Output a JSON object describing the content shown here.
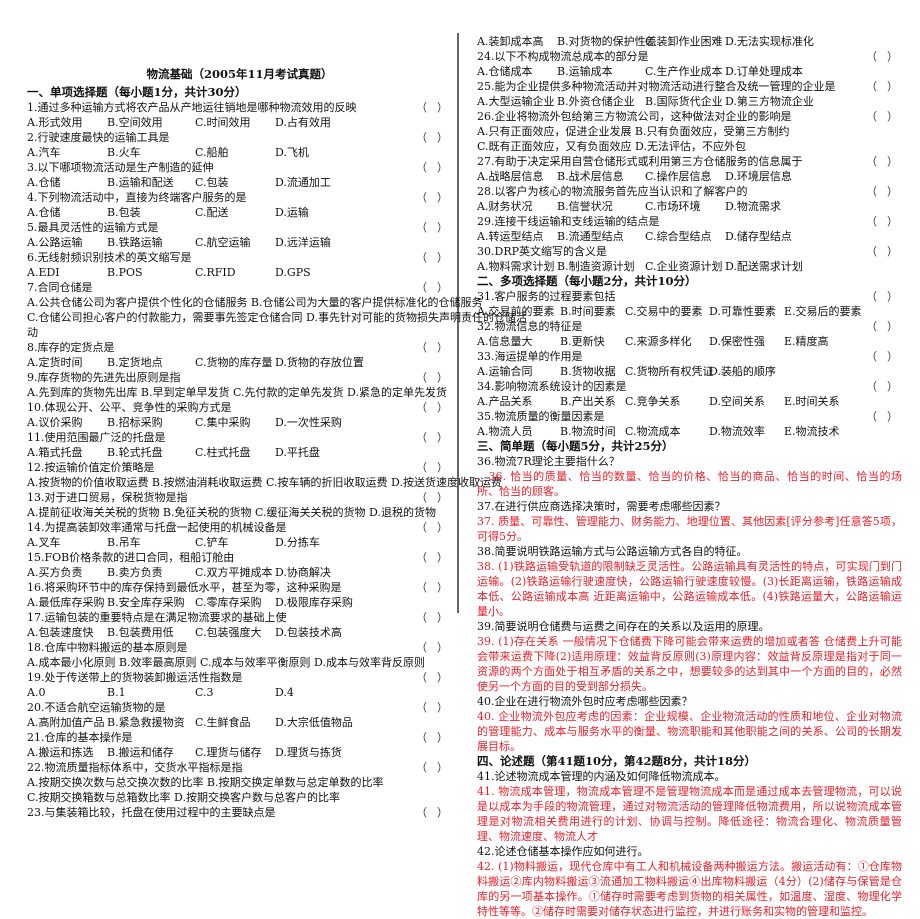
{
  "doc": {
    "title": "物流基础（2005年11月考试真题）",
    "paren_open": "（",
    "paren_close": "）",
    "colors": {
      "text": "#111111",
      "answer_red": "#e8212b",
      "divider": "#666666"
    }
  },
  "section1": {
    "heading": "一、单项选择题（每小题1分，共计30分）",
    "questions": [
      {
        "q": "1.通过多种运输方式将农产品从产地运往销地是哪种物流效用的反映",
        "opts": [
          "A.形式效用",
          "B.空间效用",
          "C.时间效用",
          "D.占有效用"
        ]
      },
      {
        "q": "2.行驶速度最快的运输工具是",
        "opts": [
          "A.汽车",
          "B.火车",
          "C.船舶",
          "D.飞机"
        ]
      },
      {
        "q": "3.以下哪项物流活动是生产制造的延伸",
        "opts": [
          "A.仓储",
          "B.运输和配送",
          "C.包装",
          "D.流通加工"
        ]
      },
      {
        "q": "4.下列物流活动中，直接为终端客户服务的是",
        "opts": [
          "A.仓储",
          "B.包装",
          "C.配送",
          "D.运输"
        ]
      },
      {
        "q": "5.最具灵活性的运输方式是",
        "opts": [
          "A.公路运输",
          "B.铁路运输",
          "C.航空运输",
          "D.远洋运输"
        ]
      },
      {
        "q": "6.无线射频识别技术的英文缩写是",
        "opts": [
          "A.EDI",
          "B.POS",
          "C.RFID",
          "D.GPS"
        ]
      },
      {
        "q": "7.合同仓储是",
        "lines": [
          "A.公共仓储公司为客户提供个性化的仓储服务  B.仓储公司为大量的客户提供标准化的仓储服务",
          "C.仓储公司担心客户的付款能力，需要事先签定仓储合同  D.事先针对可能的货物损失声明责任的仓储活",
          "动"
        ]
      },
      {
        "q": "8.库存的定货点是",
        "opts": [
          "A.定货时间",
          "B.定货地点",
          "C.货物的库存量",
          "D.货物的存放位置"
        ]
      },
      {
        "q": "9.库存货物的先进先出原则是指",
        "lines": [
          "A.先到库的货物先出库  B.早到定单早发货  C.先付款的定单先发货  D.紧急的定单先发货"
        ]
      },
      {
        "q": "10.体现公开、公平、竞争性的采购方式是",
        "opts": [
          "A.议价采购",
          "B.招标采购",
          "C.集中采购",
          "D.一次性采购"
        ]
      },
      {
        "q": "11.使用范围最广泛的托盘是",
        "opts": [
          "A.箱式托盘",
          "B.轮式托盘",
          "C.柱式托盘",
          "D.平托盘"
        ]
      },
      {
        "q": "12.按运输价值定价策略是",
        "lines": [
          "A.按货物的价值收取运费 B.按燃油消耗收取运费 C.按车辆的折旧收取运费 D.按送货速度收取运费"
        ]
      },
      {
        "q": "13.对于进口贸易，保税货物是指",
        "lines": [
          "A.提前征收海关关税的货物  B.免征关税的货物  C.缓征海关关税的货物    D.退税的货物"
        ]
      },
      {
        "q": "14.为提高装卸效率通常与托盘一起使用的机械设备是",
        "opts": [
          "A.叉车",
          "B.吊车",
          "C.铲车",
          "D.分拣车"
        ]
      },
      {
        "q": "15.FOB价格条款的进口合同，租船订舱由",
        "opts": [
          "A.买方负责",
          "B.卖方负责",
          "C.双方平摊成本",
          "D.协商解决"
        ]
      },
      {
        "q": "16.将采购环节中的库存保持到最低水平，甚至为零，这种采购是",
        "opts": [
          "A.最低库存采购",
          "B.安全库存采购",
          "C.零库存采购",
          "D.极限库存采购"
        ]
      },
      {
        "q": "17.运输包装的重要特点是在满足物流要求的基础上使",
        "opts": [
          "A.包装速度快",
          "B.包装费用低",
          "C.包装强度大",
          "D.包装技术高"
        ]
      },
      {
        "q": "18.仓库中物料搬运的基本原则是",
        "lines": [
          "A.成本最小化原则   B.效率最高原则   C.成本与效率平衡原则   D.成本与效率背反原则"
        ]
      },
      {
        "q": "19.处于传送带上的货物装卸搬运活性指数是",
        "opts": [
          "A.0",
          "B.1",
          "C.3",
          "D.4"
        ]
      },
      {
        "q": "20.不适合航空运输货物的是",
        "opts": [
          "A.高附加值产品",
          "B.紧急救援物资",
          "C.生鲜食品",
          "D.大宗低值物品"
        ]
      },
      {
        "q": "21.仓库的基本操作是",
        "opts": [
          "A.搬运和拣选",
          "B.搬运和储存",
          "C.理货与储存",
          "D.理货与拣货"
        ]
      },
      {
        "q": "22.物流质量指标体系中，交货水平指标是指",
        "lines": [
          "A.按期交换次数与总交换次数的比率        B.按期交换定单数与总定单数的比率",
          "C.按期交换箱数与总箱数比率              D.按期交换客户数与总客户的比率"
        ]
      },
      {
        "q": "23.与集装箱比较，托盘在使用过程中的主要缺点是",
        "opts": [
          "A.装卸成本高",
          "B.对货物的保护性差",
          "C.装卸作业困难",
          "D.无法实现标准化"
        ]
      },
      {
        "q": "24.以下不构成物流总成本的部分是",
        "opts": [
          "A.仓储成本",
          "B.运输成本",
          "C.生产作业成本",
          "D.订单处理成本"
        ]
      },
      {
        "q": "25.能为企业提供多种物流活动并对物流活动进行整合及统一管理的企业是",
        "opts": [
          "A.大型运输企业",
          "B.外资仓储企业",
          "B.国际货代企业",
          "D.第三方物流企业"
        ]
      },
      {
        "q": "26.企业将物流外包给第三方物流公司，这种做法对企业的影响是",
        "lines": [
          "A.只有正面效应，促进企业发展                B.只有负面效应，受第三方制约",
          "C.既有正面效应，又有负面效应                D.无法评估，不应外包"
        ]
      },
      {
        "q": "27.有助于决定采用自营仓储形式或利用第三方仓储服务的信息属于",
        "opts": [
          "A.战略层信息",
          "B.战术层信息",
          "C.操作层信息",
          "D.环境层信息"
        ]
      },
      {
        "q": "28.以客户为核心的物流服务首先应当认识和了解客户的",
        "opts": [
          "A.财务状况",
          "B.信誉状况",
          "C.市场环境",
          "D.物流需求"
        ]
      },
      {
        "q": "29.连接干线运输和支线运输的结点是",
        "opts": [
          "A.转运型结点",
          "B.流通型结点",
          "C.综合型结点",
          "D.储存型结点"
        ]
      },
      {
        "q": "30.DRP英文缩写的含义是",
        "opts": [
          "A.物料需求计划",
          "B.制造资源计划",
          "C.企业资源计划",
          "D.配送需求计划"
        ]
      }
    ]
  },
  "section2": {
    "heading": "二、多项选择题（每小题2分，共计10分）",
    "questions": [
      {
        "q": "31.客户服务的过程要素包括",
        "opts": [
          "A.交易前的要素",
          "B.时间要素",
          "C.交易中的要素",
          "D.可靠性要素",
          "E.交易后的要素"
        ]
      },
      {
        "q": "32.物流信息的特征是",
        "opts": [
          "A.信息量大",
          "B.更新快",
          "C.来源多样化",
          "D.保密性强",
          "E.精度高"
        ]
      },
      {
        "q": "33.海运提单的作用是",
        "opts": [
          "A.运输合同",
          "B.货物收据",
          "C.货物所有权凭证",
          "D.装船的顺序"
        ]
      },
      {
        "q": "34.影响物流系统设计的因素是",
        "opts": [
          "A.产品关系",
          "B.产出关系",
          "C.竞争关系",
          "D.空间关系",
          "E.时间关系"
        ]
      },
      {
        "q": "35.物流质量的衡量因素是",
        "opts": [
          "A.物流人员",
          "B.物流时间",
          "C.物流成本",
          "D.物流效率",
          "E.物流技术"
        ]
      }
    ]
  },
  "section3": {
    "heading": "三、简单题（每小题5分，共计25分）",
    "items": [
      {
        "q": "36.物流7R理论主要指什么？",
        "a": "      、36. 恰当的质量、恰当的数量、恰当的价格、恰当的商品、恰当的时间、恰当的场所、恰当的顾客。"
      },
      {
        "q": "37.在进行供应商选择决策时，需要考虑哪些因素？",
        "a": "37. 质量、可靠性、管理能力、财务能力、地理位置、其他因素[评分参考]任意答5项，可得5分。"
      },
      {
        "q": "38.简要说明铁路运输方式与公路运输方式各自的特征。",
        "a": "38. (1)铁路运输受轨道的限制缺乏灵活性。公路运输具有灵活性的特点，可实现门到门运输。(2)铁路运输行驶速度快，公路运输行驶速度较慢。(3)长距离运输，铁路运输成本低、公路运输成本高 近距离运输中，公路运输成本低。(4)铁路运量大，公路运输运量小。"
      },
      {
        "q": "39.简要说明仓储费与运费之间存在的关系以及运用的原理。",
        "a": "39. (1)存在关系 一般情况下仓储费下降可能会带来运费的增加或者答 仓储费上升可能会带来运费下降(2)适用原理：效益背反原则(3)原理内容：效益背反原理是指对于同一资源的两个方面处于相互矛盾的关系之中，想要较多的达到其中一个方面的目的，必然使另一个方面的目的受到部分损失。"
      },
      {
        "q": "40.企业在进行物流外包时应考虑哪些因素？",
        "a": "40. 企业物流外包应考虑的因素：企业规模、企业物流活动的性质和地位、企业对物流的管理能力、成本与服务水平的衡量、物流职能和其他职能之间的关系、公司的长期发展目标。"
      }
    ]
  },
  "section4": {
    "heading": "四、论述题（第41题10分，第42题8分，共计18分）",
    "items": [
      {
        "q": "41.论述物流成本管理的内涵及如何降低物流成本。",
        "a": "41. 物流成本管理，物流成本管理不是管理物流成本而是通过成本去管理物流，可以说是以成本为手段的物流管理，通过对物流活动的管理降低物流费用，所以说物流成本管理是对物流相关费用进行的计划、协调与控制。降低途径：物流合理化、物流质量管理、物流速度、物流人才"
      },
      {
        "q": "42.论述仓储基本操作应如何进行。",
        "a": "42. (1)物料搬运，现代仓库中有工人和机械设备两种搬运方法。搬运活动有：①仓库物料搬运②库内物料搬运③流通加工物料搬运④出库物料搬运（4分）(2)储存与保管是仓库的另一项基本操作。①储存时需要考虑到货物的相关属性，如温度、湿度、物理化学特性等等。②储存时需要对储存状态进行监控，并进行账务和实物的管理和监控。"
      }
    ]
  }
}
